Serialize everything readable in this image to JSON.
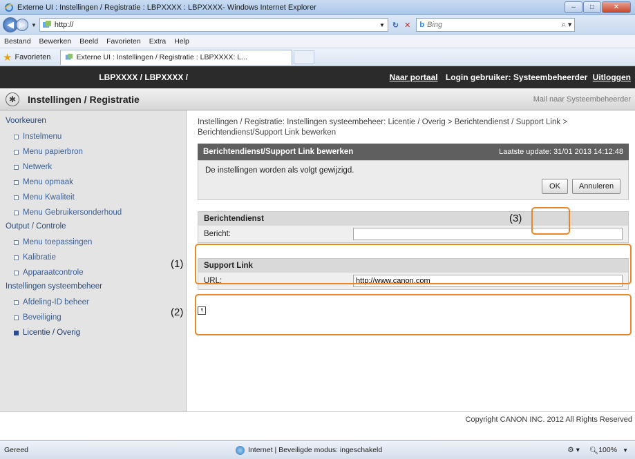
{
  "window": {
    "title": "Externe UI : Instellingen / Registratie : LBPXXXX : LBPXXXX- Windows Internet Explorer",
    "min": "–",
    "max": "□",
    "close": "✕"
  },
  "address": {
    "url": "http://",
    "search_placeholder": "Bing"
  },
  "menus": [
    "Bestand",
    "Bewerken",
    "Beeld",
    "Favorieten",
    "Extra",
    "Help"
  ],
  "favorites": {
    "label": "Favorieten",
    "tab_title": "Externe UI : Instellingen / Registratie : LBPXXXX: L..."
  },
  "topbar": {
    "device": "LBPXXXX / LBPXXXX /",
    "portal": "Naar portaal",
    "login": "Login gebruiker: Systeembeheerder",
    "logout": "Uitloggen"
  },
  "header": {
    "title": "Instellingen / Registratie",
    "mail": "Mail naar Systeembeheerder"
  },
  "sidebar": {
    "sections": [
      {
        "label": "Voorkeuren",
        "items": [
          "Instelmenu",
          "Menu papierbron",
          "Netwerk",
          "Menu opmaak",
          "Menu Kwaliteit",
          "Menu Gebruikersonderhoud"
        ]
      },
      {
        "label": "Output / Controle",
        "items": [
          "Menu toepassingen",
          "Kalibratie",
          "Apparaatcontrole"
        ]
      },
      {
        "label": "Instellingen systeembeheer",
        "items": [
          "Afdeling-ID beheer",
          "Beveiliging",
          "Licentie / Overig"
        ]
      }
    ]
  },
  "main": {
    "breadcrumb": "Instellingen / Registratie: Instellingen systeembeheer: Licentie / Overig > Berichtendienst / Support Link > Berichtendienst/Support Link bewerken",
    "panel_title": "Berichtendienst/Support Link bewerken",
    "last_update": "Laatste update: 31/01 2013 14:12:48",
    "message": "De instellingen worden als volgt gewijzigd.",
    "ok": "OK",
    "cancel": "Annuleren",
    "section1": {
      "title": "Berichtendienst",
      "label": "Bericht:",
      "value": ""
    },
    "section2": {
      "title": "Support Link",
      "label": "URL:",
      "value": "http://www.canon.com"
    },
    "callouts": [
      "(1)",
      "(2)",
      "(3)"
    ],
    "top_icon": "⯭"
  },
  "footer": {
    "copyright": "Copyright CANON INC. 2012 All Rights Reserved"
  },
  "status": {
    "left": "Gereed",
    "zone": "Internet | Beveiligde modus: ingeschakeld",
    "zoom": "100%"
  },
  "colors": {
    "highlight": "#e8872a",
    "topbar": "#2b2b2b",
    "panel_header": "#5f5f5f"
  }
}
